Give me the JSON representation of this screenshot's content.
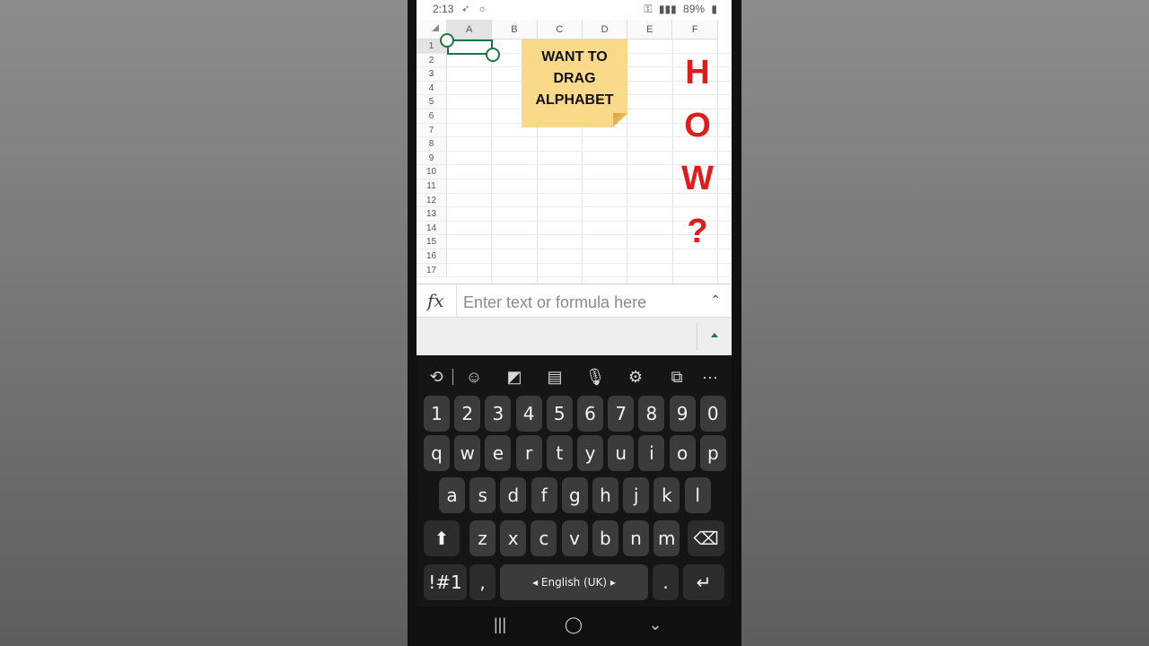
{
  "status_bar": {
    "time": "2:13",
    "left_icons": "➶ ☼",
    "key_icon": "⚿",
    "signal": "▮▮▮",
    "battery_percent": "89%",
    "battery_icon": "▮"
  },
  "sheet": {
    "columns": [
      "A",
      "B",
      "C",
      "D",
      "E",
      "F"
    ],
    "rows": [
      "1",
      "2",
      "3",
      "4",
      "5",
      "6",
      "7",
      "8",
      "9",
      "10",
      "11",
      "12",
      "13",
      "14",
      "15",
      "16",
      "17"
    ],
    "selected_cell": "A1",
    "sticky_note": [
      "WANT TO",
      "DRAG",
      "ALPHABET"
    ],
    "how_letters": [
      "H",
      "O",
      "W",
      "?"
    ],
    "how_color": "#e31a1a",
    "note_color": "#fbd98a",
    "selection_color": "#217346"
  },
  "formula_bar": {
    "fx_label": "fx",
    "placeholder": "Enter text or formula here",
    "value": "",
    "chevron": "⌃"
  },
  "keyboard": {
    "toolbar_icons": [
      "translate-icon",
      "emoji-icon",
      "sticker-icon",
      "clipboard-icon",
      "mic-icon",
      "settings-icon",
      "screen-translate-icon",
      "more-icon"
    ],
    "toolbar_glyphs": [
      "⟲",
      "☺",
      "◩",
      "▤",
      "🎙",
      "⚙",
      "⧉",
      "···"
    ],
    "number_row": [
      "1",
      "2",
      "3",
      "4",
      "5",
      "6",
      "7",
      "8",
      "9",
      "0"
    ],
    "row1": [
      "q",
      "w",
      "e",
      "r",
      "t",
      "y",
      "u",
      "i",
      "o",
      "p"
    ],
    "row2": [
      "a",
      "s",
      "d",
      "f",
      "g",
      "h",
      "j",
      "k",
      "l"
    ],
    "row3": [
      "z",
      "x",
      "c",
      "v",
      "b",
      "n",
      "m"
    ],
    "shift": "⬆",
    "backspace": "⌫",
    "symbols": "!#1",
    "comma": ",",
    "space_label": "◂ English (UK) ▸",
    "period": ".",
    "enter": "↵"
  },
  "nav_bar": {
    "recents": "|||",
    "home": "◯",
    "back": "⌄"
  }
}
